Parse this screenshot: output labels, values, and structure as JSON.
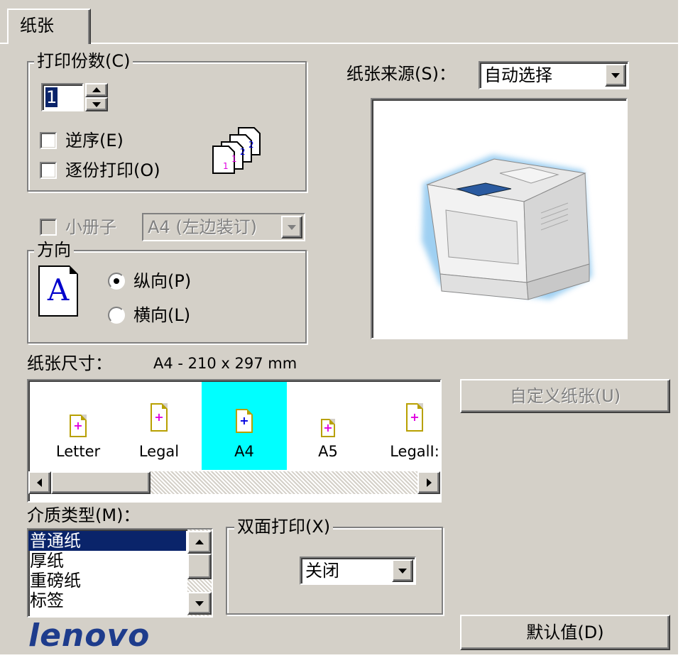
{
  "tab": {
    "label": "纸张"
  },
  "copies_group": {
    "title": "打印份数(C)",
    "value": "1",
    "reverse_label": "逆序(E)",
    "collate_label": "逐份打印(O)"
  },
  "paper_source": {
    "label": "纸张来源(S)：",
    "value": "自动选择"
  },
  "booklet": {
    "label": "小册子",
    "value": "A4 (左边装订)"
  },
  "orientation_group": {
    "title": "方向",
    "icon_letter": "A",
    "portrait_label": "纵向(P)",
    "landscape_label": "横向(L)",
    "selected": "portrait"
  },
  "paper_size": {
    "label": "纸张尺寸：",
    "value": "A4 - 210 x 297 mm",
    "items": [
      {
        "name": "Letter"
      },
      {
        "name": "Legal"
      },
      {
        "name": "A4"
      },
      {
        "name": "A5"
      },
      {
        "name": "LegalI:"
      }
    ],
    "selected_index": 2,
    "selected_color": "#00ffff"
  },
  "custom_paper_button": {
    "label": "自定义纸张(U)"
  },
  "media_type": {
    "label": "介质类型(M)：",
    "items": [
      "普通纸",
      "厚纸",
      "重磅纸",
      "标签"
    ],
    "selected_index": 0
  },
  "duplex_group": {
    "title": "双面打印(X)",
    "value": "关闭"
  },
  "defaults_button": {
    "label": "默认值(D)"
  },
  "brand": {
    "logo": "lenovo",
    "color": "#1e3c8c"
  }
}
